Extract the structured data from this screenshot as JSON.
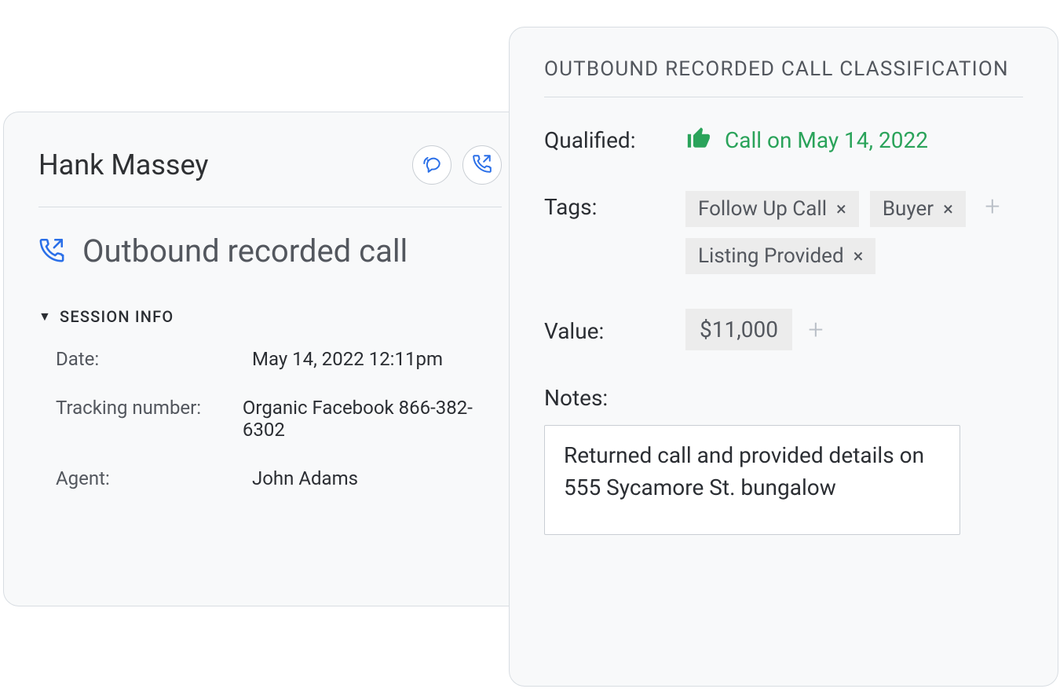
{
  "leftCard": {
    "contactName": "Hank Massey",
    "callTitle": "Outbound recorded call",
    "sessionHeader": "SESSION INFO",
    "session": {
      "dateLabel": "Date:",
      "dateValue": "May 14, 2022 12:11pm",
      "trackingLabel": "Tracking number:",
      "trackingValue": "Organic Facebook 866-382-6302",
      "agentLabel": "Agent:",
      "agentValue": "John Adams"
    }
  },
  "rightCard": {
    "title": "OUTBOUND RECORDED CALL CLASSIFICATION",
    "qualifiedLabel": "Qualified:",
    "qualifiedText": "Call on May 14, 2022",
    "tagsLabel": "Tags:",
    "tags": [
      "Follow Up Call",
      "Buyer",
      "Listing Provided"
    ],
    "valueLabel": "Value:",
    "valueAmount": "$11,000",
    "notesLabel": "Notes:",
    "notesText": "Returned call and provided details on 555 Sycamore St. bungalow"
  }
}
